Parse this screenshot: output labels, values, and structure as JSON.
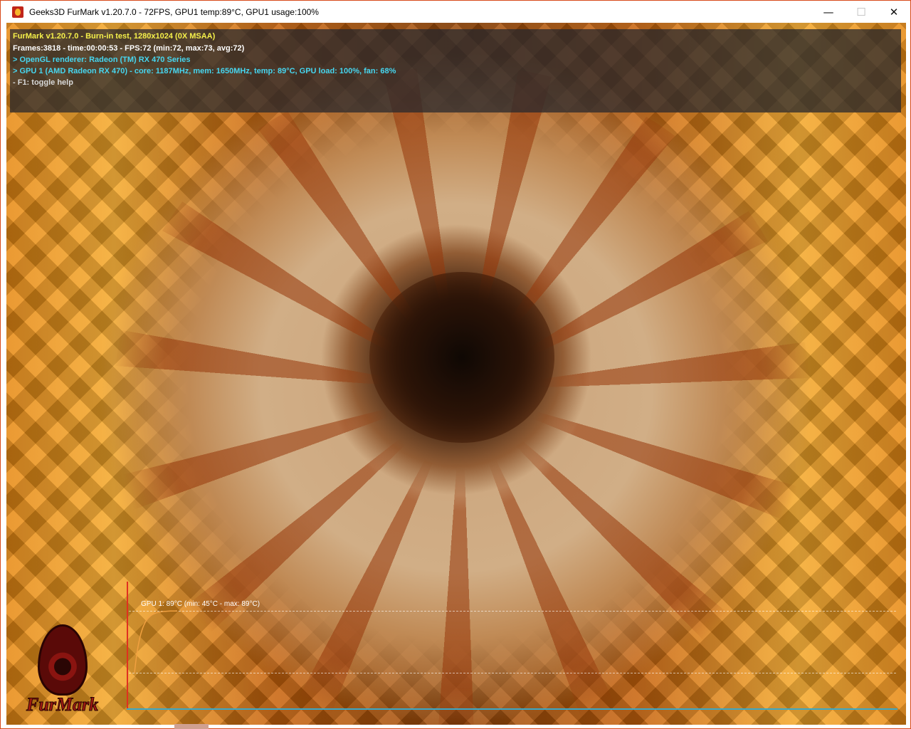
{
  "window": {
    "title": "Geeks3D FurMark v1.20.7.0 - 72FPS, GPU1 temp:89°C, GPU1 usage:100%",
    "controls": {
      "minimize": "—",
      "maximize": "☐",
      "close": "✕"
    },
    "app_icon": "furmark-flame-icon"
  },
  "overlay": {
    "line1": "FurMark v1.20.7.0 - Burn-in test, 1280x1024 (0X MSAA)",
    "line2": "Frames:3818 - time:00:00:53 - FPS:72 (min:72, max:73, avg:72)",
    "line3": "> OpenGL renderer: Radeon (TM) RX 470 Series",
    "line4": "> GPU 1 (AMD Radeon RX 470) - core: 1187MHz, mem: 1650MHz, temp: 89°C, GPU load: 100%, fan: 68%",
    "line5": "- F1: toggle help",
    "colors": {
      "title": "#f5f04a",
      "stats": "#ffffff",
      "gpu": "#46d6f0",
      "help": "#d8d8d8"
    }
  },
  "temperature_graph": {
    "label": "GPU 1: 89°C (min: 45°C - max: 89°C)",
    "current_c": 89,
    "min_c": 45,
    "max_c": 89,
    "line_color": "#f0a040"
  },
  "logo": {
    "text": "FurMark",
    "icon": "furmark-logo-icon"
  }
}
